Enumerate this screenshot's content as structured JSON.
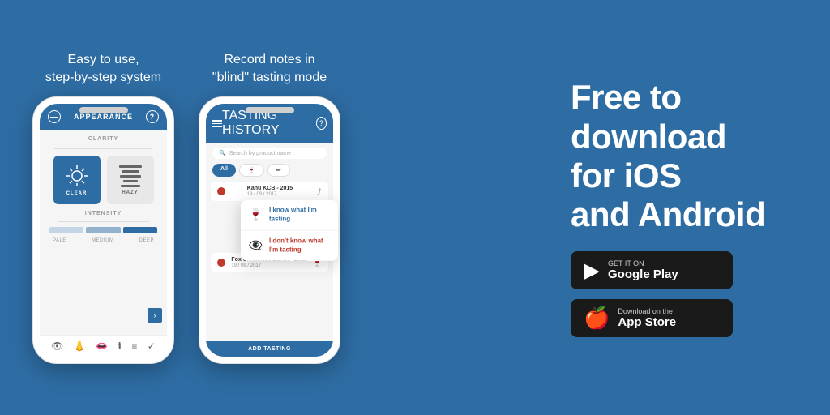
{
  "background_color": "#2e6da4",
  "phone1": {
    "caption": "Easy to use,\nstep-by-step system",
    "header": {
      "title": "APPEARANCE",
      "left_icon": "minus-circle",
      "right_icon": "question-circle"
    },
    "clarity": {
      "label": "CLARITY",
      "options": [
        {
          "name": "CLEAR",
          "selected": true
        },
        {
          "name": "HAZY",
          "selected": false
        }
      ]
    },
    "intensity": {
      "label": "INTENSITY",
      "levels": [
        "PALE",
        "MEDIUM",
        "DEEP"
      ]
    }
  },
  "phone2": {
    "caption": "Record notes in\n\"blind\" tasting mode",
    "header": {
      "title": "TASTING HISTORY",
      "right_icon": "question-circle"
    },
    "search_placeholder": "Search by product name",
    "filters": [
      "All",
      "🍷",
      "✏️"
    ],
    "tastings": [
      {
        "name": "Kanu KCB - 2015",
        "date": "19 / 09 / 2017"
      },
      {
        "name": "Fox Creek Red Baron - 2015",
        "date": "19 / 09 / 2017"
      }
    ],
    "popup": {
      "option1": "I know what I'm tasting",
      "option2": "I don't know what I'm tasting"
    },
    "add_button": "ADD TASTING"
  },
  "right": {
    "headline": "Free to\ndownload\nfor iOS\nand Android",
    "google_play": {
      "sub": "GET IT ON",
      "name": "Google Play"
    },
    "app_store": {
      "sub": "Download on the",
      "name": "App Store"
    }
  }
}
